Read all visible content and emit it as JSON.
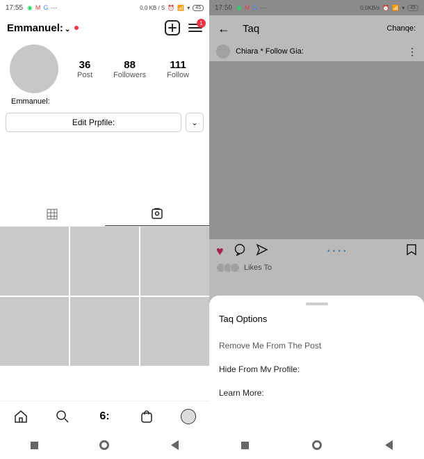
{
  "left": {
    "status": {
      "time": "17:55",
      "data_rate": "0,0 KB / S"
    },
    "header": {
      "username": "Emmanuel:",
      "menu_badge": "1"
    },
    "profile": {
      "stats": [
        {
          "num": "36",
          "lbl": "Post"
        },
        {
          "num": "88",
          "lbl": "Followers"
        },
        {
          "num": "111",
          "lbl": "Follow"
        }
      ],
      "display_name": "Emmanuel:"
    },
    "edit_label": "Edit Prpfile:",
    "bottom_nav_label": "6:"
  },
  "right": {
    "status": {
      "time": "17:50",
      "data_rate": "0,0KB/s"
    },
    "header": {
      "title": "Taq",
      "action": "Chanqe:"
    },
    "userbar": {
      "text": "Chiara * Follow Gia:"
    },
    "dots_indicator": "• • • •",
    "likes_label": "Likes To",
    "sheet": {
      "title": "Taq Options",
      "items": [
        "Remove Me From The Post",
        "Hide From Mv Profile:",
        "Learn More:"
      ]
    }
  },
  "battery": "45"
}
